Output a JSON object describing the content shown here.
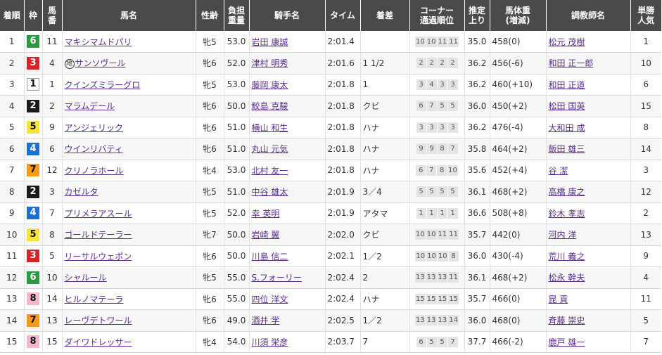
{
  "headers": {
    "rank": "着順",
    "waku": "枠",
    "num": "馬\n番",
    "horse": "馬名",
    "sexage": "性齢",
    "weight": "負担\n重量",
    "jockey": "騎手名",
    "time": "タイム",
    "margin": "着差",
    "corner": "コーナー\n通過順位",
    "last3f": "推定\n上り",
    "bodyweight": "馬体重\n(増減)",
    "trainer": "調教師名",
    "odds": "単勝\n人気"
  },
  "rows": [
    {
      "rank": "1",
      "waku": "6",
      "num": "11",
      "horse": "マキシマムドパリ",
      "mark": "",
      "sexage": "牝5",
      "weight": "53.0",
      "jockey": "岩田 康誠",
      "time": "2:01.4",
      "margin": "",
      "corner": [
        "10",
        "10",
        "11",
        "11"
      ],
      "last3f": "35.0",
      "bw": "458",
      "bwd": "(0)",
      "trainer": "松元 茂樹",
      "pop": "1"
    },
    {
      "rank": "2",
      "waku": "3",
      "num": "4",
      "horse": "サンソヴール",
      "mark": "地",
      "sexage": "牝6",
      "weight": "52.0",
      "jockey": "津村 明秀",
      "time": "2:01.6",
      "margin": "1 1/2",
      "corner": [
        "2",
        "2",
        "2",
        "2"
      ],
      "last3f": "36.2",
      "bw": "456",
      "bwd": "(-6)",
      "trainer": "和田 正一郎",
      "pop": "10"
    },
    {
      "rank": "3",
      "waku": "1",
      "num": "1",
      "horse": "クインズミラーグロ",
      "mark": "",
      "sexage": "牝5",
      "weight": "53.0",
      "jockey": "藤岡 康太",
      "time": "2:01.8",
      "margin": "1",
      "corner": [
        "3",
        "4",
        "3",
        "3"
      ],
      "last3f": "36.2",
      "bw": "460",
      "bwd": "(+10)",
      "trainer": "和田 正道",
      "pop": "6"
    },
    {
      "rank": "4",
      "waku": "2",
      "num": "2",
      "horse": "マラムデール",
      "mark": "",
      "sexage": "牝6",
      "weight": "50.0",
      "jockey": "鮫島 克駿",
      "time": "2:01.8",
      "margin": "クビ",
      "corner": [
        "6",
        "7",
        "5",
        "5"
      ],
      "last3f": "36.0",
      "bw": "450",
      "bwd": "(+2)",
      "trainer": "松田 国英",
      "pop": "15"
    },
    {
      "rank": "5",
      "waku": "5",
      "num": "9",
      "horse": "アンジェリック",
      "mark": "",
      "sexage": "牝6",
      "weight": "51.0",
      "jockey": "横山 和生",
      "time": "2:01.8",
      "margin": "ハナ",
      "corner": [
        "3",
        "3",
        "3",
        "3"
      ],
      "last3f": "36.2",
      "bw": "476",
      "bwd": "(-4)",
      "trainer": "大和田 成",
      "pop": "8"
    },
    {
      "rank": "6",
      "waku": "4",
      "num": "6",
      "horse": "ウインリバティ",
      "mark": "",
      "sexage": "牝6",
      "weight": "51.0",
      "jockey": "丸山 元気",
      "time": "2:01.8",
      "margin": "ハナ",
      "corner": [
        "9",
        "9",
        "8",
        "7"
      ],
      "last3f": "35.8",
      "bw": "464",
      "bwd": "(+2)",
      "trainer": "飯田 雄三",
      "pop": "14"
    },
    {
      "rank": "7",
      "waku": "7",
      "num": "12",
      "horse": "クリノラホール",
      "mark": "",
      "sexage": "牝4",
      "weight": "53.0",
      "jockey": "北村 友一",
      "time": "2:01.8",
      "margin": "ハナ",
      "corner": [
        "6",
        "7",
        "8",
        "10"
      ],
      "last3f": "35.6",
      "bw": "452",
      "bwd": "(+4)",
      "trainer": "谷 潔",
      "pop": "3"
    },
    {
      "rank": "8",
      "waku": "2",
      "num": "3",
      "horse": "カゼルタ",
      "mark": "",
      "sexage": "牝5",
      "weight": "51.0",
      "jockey": "中谷 雄太",
      "time": "2:01.9",
      "margin": "3／4",
      "corner": [
        "5",
        "5",
        "5",
        "5"
      ],
      "last3f": "36.1",
      "bw": "468",
      "bwd": "(+2)",
      "trainer": "高橋 康之",
      "pop": "12"
    },
    {
      "rank": "9",
      "waku": "4",
      "num": "7",
      "horse": "プリメラアスール",
      "mark": "",
      "sexage": "牝5",
      "weight": "52.0",
      "jockey": "幸 英明",
      "time": "2:01.9",
      "margin": "アタマ",
      "corner": [
        "1",
        "1",
        "1",
        "1"
      ],
      "last3f": "36.6",
      "bw": "508",
      "bwd": "(+8)",
      "trainer": "鈴木 孝志",
      "pop": "2"
    },
    {
      "rank": "10",
      "waku": "5",
      "num": "8",
      "horse": "ゴールドテーラー",
      "mark": "",
      "sexage": "牝7",
      "weight": "50.0",
      "jockey": "岩崎 翼",
      "time": "2:02.0",
      "margin": "クビ",
      "corner": [
        "10",
        "10",
        "11",
        "11"
      ],
      "last3f": "35.7",
      "bw": "442",
      "bwd": "(0)",
      "trainer": "河内 洋",
      "pop": "13"
    },
    {
      "rank": "11",
      "waku": "3",
      "num": "5",
      "horse": "リーサルウェポン",
      "mark": "",
      "sexage": "牝6",
      "weight": "50.0",
      "jockey": "川島 信二",
      "time": "2:02.1",
      "margin": "1／2",
      "corner": [
        "10",
        "10",
        "10",
        "8"
      ],
      "last3f": "36.0",
      "bw": "430",
      "bwd": "(-4)",
      "trainer": "荒川 義之",
      "pop": "9"
    },
    {
      "rank": "12",
      "waku": "6",
      "num": "10",
      "horse": "シャルール",
      "mark": "",
      "sexage": "牝5",
      "weight": "55.0",
      "jockey": "S.フォーリー",
      "time": "2:02.4",
      "margin": "2",
      "corner": [
        "13",
        "13",
        "13",
        "11"
      ],
      "last3f": "36.1",
      "bw": "468",
      "bwd": "(+2)",
      "trainer": "松永 幹夫",
      "pop": "4"
    },
    {
      "rank": "13",
      "waku": "8",
      "num": "14",
      "horse": "ヒルノマテーラ",
      "mark": "",
      "sexage": "牝6",
      "weight": "55.0",
      "jockey": "四位 洋文",
      "time": "2:02.4",
      "margin": "ハナ",
      "corner": [
        "15",
        "15",
        "15",
        "15"
      ],
      "last3f": "35.7",
      "bw": "466",
      "bwd": "(0)",
      "trainer": "昆 貢",
      "pop": "11"
    },
    {
      "rank": "14",
      "waku": "7",
      "num": "13",
      "horse": "レーヴデトワール",
      "mark": "",
      "sexage": "牝6",
      "weight": "49.0",
      "jockey": "酒井 学",
      "time": "2:02.5",
      "margin": "1／2",
      "corner": [
        "13",
        "13",
        "13",
        "14"
      ],
      "last3f": "36.0",
      "bw": "468",
      "bwd": "(0)",
      "trainer": "斉藤 崇史",
      "pop": "5"
    },
    {
      "rank": "15",
      "waku": "8",
      "num": "15",
      "horse": "ダイワドレッサー",
      "mark": "",
      "sexage": "牝4",
      "weight": "54.0",
      "jockey": "川須 栄彦",
      "time": "2:03.7",
      "margin": "7",
      "corner": [
        "6",
        "5",
        "5",
        "7"
      ],
      "last3f": "37.7",
      "bw": "466",
      "bwd": "(-2)",
      "trainer": "鹿戸 雄一",
      "pop": "7"
    }
  ]
}
